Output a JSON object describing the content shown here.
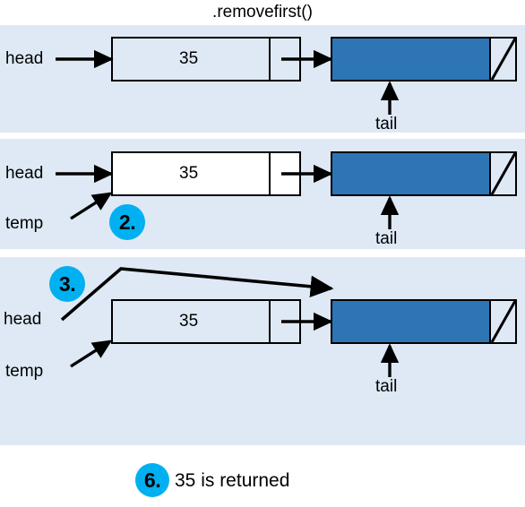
{
  "title": ".removefirst()",
  "colors": {
    "panel_background": "#dee9f5",
    "page_background": "#ffffff",
    "node_fill_blue": "#2e75b6",
    "node_fill_white": "#ffffff",
    "badge_fill": "#00b0f0",
    "stroke": "#000000"
  },
  "panels": [
    {
      "id": "panel-1",
      "labels": {
        "head": "head",
        "tail": "tail"
      },
      "node_value": "35",
      "node_fill": "transparent",
      "tail_node_fill": "#2e75b6",
      "badge": null
    },
    {
      "id": "panel-2",
      "labels": {
        "head": "head",
        "temp": "temp",
        "tail": "tail"
      },
      "node_value": "35",
      "node_fill": "#ffffff",
      "tail_node_fill": "#2e75b6",
      "badge": "2."
    },
    {
      "id": "panel-3",
      "labels": {
        "head": "head",
        "temp": "temp",
        "tail": "tail"
      },
      "node_value": "35",
      "node_fill": "transparent",
      "tail_node_fill": "#2e75b6",
      "badge": "3."
    }
  ],
  "footer": {
    "badge": "6.",
    "text": "35 is returned"
  }
}
